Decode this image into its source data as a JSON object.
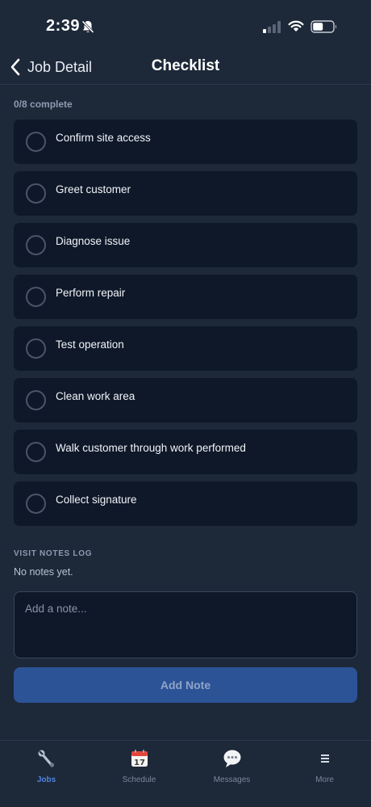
{
  "status_bar": {
    "time": "2:39"
  },
  "header": {
    "back_label": "Job Detail",
    "title": "Checklist"
  },
  "checklist": {
    "progress": "0/8 complete",
    "items": [
      {
        "label": "Confirm site access",
        "checked": false
      },
      {
        "label": "Greet customer",
        "checked": false
      },
      {
        "label": "Diagnose issue",
        "checked": false
      },
      {
        "label": "Perform repair",
        "checked": false
      },
      {
        "label": "Test operation",
        "checked": false
      },
      {
        "label": "Clean work area",
        "checked": false
      },
      {
        "label": "Walk customer through work performed",
        "checked": false
      },
      {
        "label": "Collect signature",
        "checked": false
      }
    ]
  },
  "notes": {
    "heading": "VISIT NOTES LOG",
    "empty_text": "No notes yet.",
    "input_value": "",
    "input_placeholder": "Add a note...",
    "add_button_label": "Add Note"
  },
  "tab_bar": {
    "tabs": [
      {
        "label": "Jobs",
        "icon": "wrench-icon",
        "active": true
      },
      {
        "label": "Schedule",
        "icon": "calendar-icon",
        "active": false
      },
      {
        "label": "Messages",
        "icon": "speech-bubble-icon",
        "active": false
      },
      {
        "label": "More",
        "icon": "menu-icon",
        "active": false
      }
    ]
  },
  "colors": {
    "background": "#1d2839",
    "card": "#0e1829",
    "accent": "#4f83e0",
    "button": "#2c5396"
  }
}
